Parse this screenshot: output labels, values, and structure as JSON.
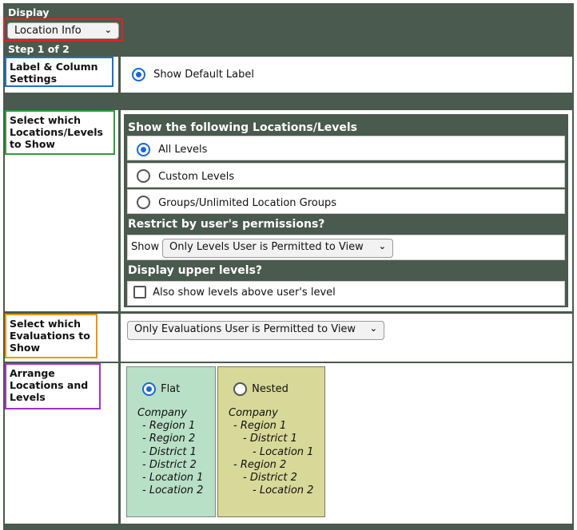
{
  "display": {
    "label": "Display",
    "selected": "Location Info"
  },
  "step": {
    "label": "Step 1 of 2"
  },
  "label_settings": {
    "label": "Label & Column Settings",
    "option": "Show Default Label"
  },
  "locations": {
    "label": "Select which Locations/Levels to Show",
    "panel_title": "Show the following Locations/Levels",
    "options": [
      "All Levels",
      "Custom Levels",
      "Groups/Unlimited Location Groups"
    ],
    "restrict_title": "Restrict by user's permissions?",
    "show_prefix": "Show",
    "restrict_selected": "Only Levels User is Permitted to View",
    "upper_title": "Display upper levels?",
    "upper_checkbox": "Also show levels above user's level"
  },
  "evaluations": {
    "label": "Select which Evaluations to Show",
    "selected": "Only Evaluations User is Permitted to View"
  },
  "arrange": {
    "label": "Arrange Locations and Levels",
    "flat": {
      "label": "Flat",
      "lines": [
        "Company",
        "- Region 1",
        "- Region 2",
        "- District 1",
        "- District 2",
        "- Location 1",
        "- Location 2"
      ]
    },
    "nested": {
      "label": "Nested",
      "lines": [
        "Company",
        "- Region 1",
        "- District 1",
        "- Location 1",
        "- Region 2",
        "- District 2",
        "- Location 2"
      ]
    }
  },
  "colors": {
    "frame": "#4a5a4e",
    "accent": "#1a66d8",
    "flat_bg": "#b8e0c6",
    "nested_bg": "#d8d899"
  }
}
